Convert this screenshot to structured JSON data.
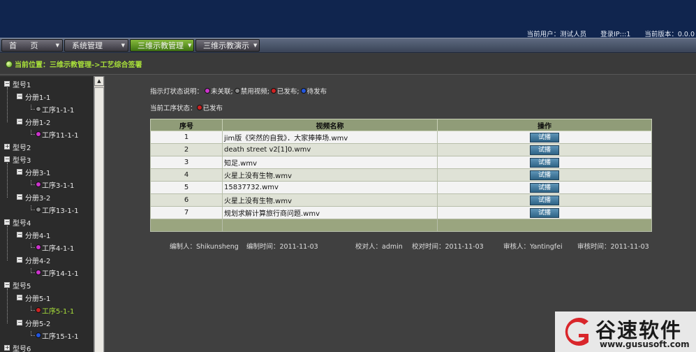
{
  "header": {
    "user_label": "当前用户：测试人员",
    "ip_label": "登录IP:::1",
    "version_label": "当前版本：0.0.0"
  },
  "nav": {
    "items": [
      {
        "label": "首 页"
      },
      {
        "label": "系统管理"
      },
      {
        "label": "三维示教管理",
        "active": true
      },
      {
        "label": "三维示教演示"
      }
    ],
    "arrow_icon": "triangle-down-icon"
  },
  "breadcrumb": {
    "text": "当前位置：三维示教管理->工艺综合签署"
  },
  "tree": {
    "nodes": [
      {
        "label": "型号1",
        "level": 0,
        "toggle": "−"
      },
      {
        "label": "分册1-1",
        "level": 1,
        "toggle": "−"
      },
      {
        "label": "工序1-1-1",
        "level": 2,
        "dot": "#8a8a8a"
      },
      {
        "label": "分册1-2",
        "level": 1,
        "toggle": "−"
      },
      {
        "label": "工序11-1-1",
        "level": 2,
        "dot": "#cc33cc"
      },
      {
        "label": "型号2",
        "level": 0,
        "toggle": "+"
      },
      {
        "label": "型号3",
        "level": 0,
        "toggle": "−"
      },
      {
        "label": "分册3-1",
        "level": 1,
        "toggle": "−"
      },
      {
        "label": "工序3-1-1",
        "level": 2,
        "dot": "#cc33cc"
      },
      {
        "label": "分册3-2",
        "level": 1,
        "toggle": "−"
      },
      {
        "label": "工序13-1-1",
        "level": 2,
        "dot": "#8a8a8a"
      },
      {
        "label": "型号4",
        "level": 0,
        "toggle": "−"
      },
      {
        "label": "分册4-1",
        "level": 1,
        "toggle": "−"
      },
      {
        "label": "工序4-1-1",
        "level": 2,
        "dot": "#cc33cc"
      },
      {
        "label": "分册4-2",
        "level": 1,
        "toggle": "−"
      },
      {
        "label": "工序14-1-1",
        "level": 2,
        "dot": "#cc33cc"
      },
      {
        "label": "型号5",
        "level": 0,
        "toggle": "−"
      },
      {
        "label": "分册5-1",
        "level": 1,
        "toggle": "−"
      },
      {
        "label": "工序5-1-1",
        "level": 2,
        "dot": "#cc2222",
        "selected": true
      },
      {
        "label": "分册5-2",
        "level": 1,
        "toggle": "−"
      },
      {
        "label": "工序15-1-1",
        "level": 2,
        "dot": "#2255dd"
      },
      {
        "label": "型号6",
        "level": 0,
        "toggle": "+"
      }
    ]
  },
  "legend": {
    "label": "指示灯状态说明：",
    "items": [
      {
        "label": "未关联;",
        "color": "#cc33cc"
      },
      {
        "label": "禁用视频;",
        "color": "#8a8a8a"
      },
      {
        "label": "已发布;",
        "color": "#cc2222"
      },
      {
        "label": "待发布",
        "color": "#2255dd"
      }
    ]
  },
  "status": {
    "label": "当前工序状态：",
    "value": "已发布",
    "color": "#cc2222"
  },
  "table": {
    "headers": [
      "序号",
      "视频名称",
      "操作"
    ],
    "rows": [
      {
        "no": "1",
        "name": "jim版《突然的自我》．大家捧捧场.wmv"
      },
      {
        "no": "2",
        "name": "death street v2[1]0.wmv"
      },
      {
        "no": "3",
        "name": "知足.wmv"
      },
      {
        "no": "4",
        "name": "火星上没有生物.wmv"
      },
      {
        "no": "5",
        "name": "15837732.wmv"
      },
      {
        "no": "6",
        "name": "火星上没有生物.wmv"
      },
      {
        "no": "7",
        "name": "规划求解计算旅行商问题.wmv"
      }
    ],
    "play_label": "试播"
  },
  "signoff": {
    "editor": "编制人：Shikunsheng",
    "edit_time": "编制时间：2011-11-03",
    "checker": "校对人：admin",
    "check_time": "校对时间：2011-11-03",
    "reviewer": "审核人：Yantingfei",
    "review_time": "审核时间：2011-11-03"
  },
  "watermark": {
    "title": "谷速软件",
    "url": "www.gususoft.com",
    "logo_color": "#d9262b"
  },
  "colors": {
    "banner": "#10254e",
    "accent_green": "#a9e03a",
    "table_header": "#909c78",
    "button_blue": "#2f6486"
  }
}
